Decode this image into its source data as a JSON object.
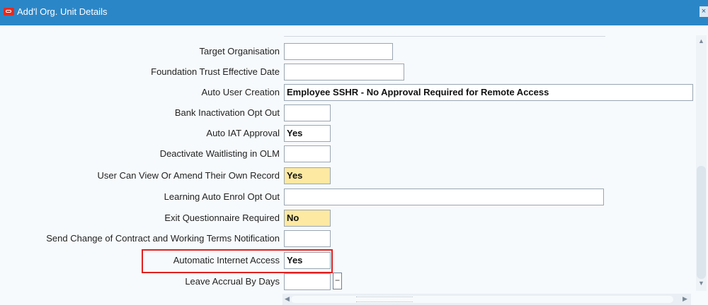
{
  "window": {
    "title": "Add'l Org. Unit Details",
    "close_glyph": "×"
  },
  "fields": [
    {
      "label": "Target Organisation",
      "value": ""
    },
    {
      "label": "Foundation Trust Effective Date",
      "value": ""
    },
    {
      "label": "Auto User Creation",
      "value": "Employee SSHR - No Approval Required for Remote Access"
    },
    {
      "label": "Bank Inactivation Opt Out",
      "value": ""
    },
    {
      "label": "Auto IAT Approval",
      "value": "Yes"
    },
    {
      "label": "Deactivate Waitlisting in OLM",
      "value": ""
    },
    {
      "label": "User Can View Or Amend Their Own Record",
      "value": "Yes"
    },
    {
      "label": "Learning Auto Enrol Opt Out",
      "value": ""
    },
    {
      "label": "Exit Questionnaire Required",
      "value": "No"
    },
    {
      "label": "Send Change of Contract and Working Terms Notification",
      "value": ""
    },
    {
      "label": "Automatic Internet Access",
      "value": "Yes"
    },
    {
      "label": "Leave Accrual By Days",
      "value": ""
    }
  ],
  "lov_button_glyph": "−",
  "scrollbar": {
    "up_glyph": "▲",
    "down_glyph": "▼",
    "left_glyph": "◀",
    "right_glyph": "▶"
  },
  "colors": {
    "titlebar": "#2b86c7",
    "highlight_field": "#fde9a1",
    "annotation_box": "#e0201f"
  }
}
